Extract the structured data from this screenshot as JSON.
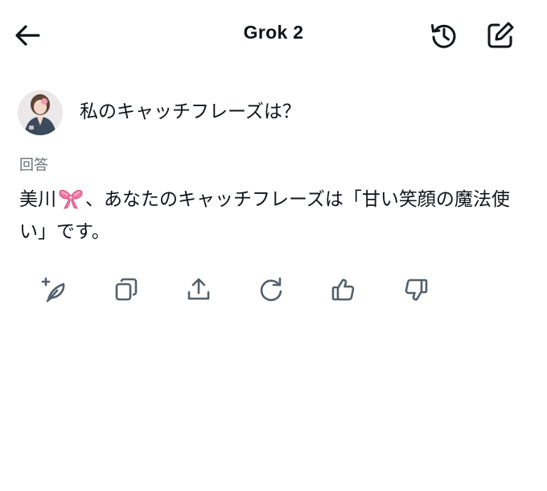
{
  "header": {
    "title": "Grok 2",
    "icons": [
      "back-arrow-icon",
      "history-icon",
      "compose-icon"
    ]
  },
  "question": {
    "avatar_icon": "user-avatar",
    "text": "私のキャッチフレーズは？"
  },
  "answer": {
    "label": "回答",
    "name": "美川",
    "emoji_icon": "ribbon-icon",
    "body": "、あなたのキャッチフレーズは「甘い笑顔の魔法使い」です。"
  },
  "actions": {
    "icons": [
      "regenerate-feather-icon",
      "copy-icon",
      "share-icon",
      "refresh-icon",
      "thumbs-up-icon",
      "thumbs-down-icon"
    ]
  },
  "colors": {
    "text": "#0f1419",
    "muted": "#66707a",
    "icon": "#53606b",
    "ribbon": "#f07aa5"
  }
}
